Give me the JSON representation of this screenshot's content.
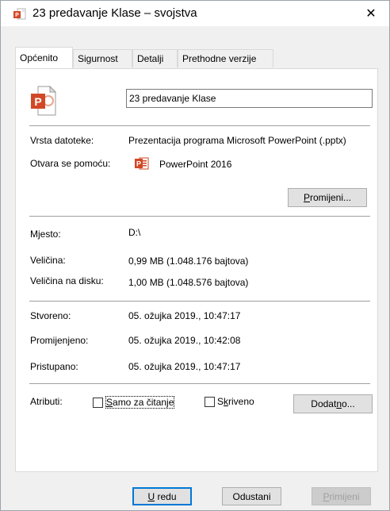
{
  "window": {
    "title": "23 predavanje Klase – svojstva",
    "close_glyph": "✕"
  },
  "tabs": [
    {
      "label": "Općenito",
      "active": true
    },
    {
      "label": "Sigurnost",
      "active": false
    },
    {
      "label": "Detalji",
      "active": false
    },
    {
      "label": "Prethodne verzije",
      "active": false
    }
  ],
  "general": {
    "file_name": "23 predavanje Klase",
    "file_type_label": "Vrsta datoteke:",
    "file_type_value": "Prezentacija programa Microsoft PowerPoint (.pptx)",
    "opens_with_label": "Otvara se pomoću:",
    "opens_with_value": "PowerPoint 2016",
    "change_button": {
      "pre": "P",
      "rest": "romijeni..."
    },
    "location_label": "Mjesto:",
    "location_value": "D:\\",
    "size_label": "Veličina:",
    "size_value": "0,99 MB (1.048.176 bajtova)",
    "size_on_disk_label": "Veličina na disku:",
    "size_on_disk_value": "1,00 MB (1.048.576 bajtova)",
    "created_label": "Stvoreno:",
    "created_value": "05. ožujka 2019., 10:47:17",
    "modified_label": "Promijenjeno:",
    "modified_value": "05. ožujka 2019., 10:42:08",
    "accessed_label": "Pristupano:",
    "accessed_value": "05. ožujka 2019., 10:47:17",
    "attributes_label": "Atributi:",
    "readonly": {
      "pre": "S",
      "rest": "amo za čitanje",
      "checked": false
    },
    "hidden": {
      "pre": "S",
      "mid": "k",
      "rest": "riveno",
      "checked": false
    },
    "advanced_button": {
      "pre": "Dodat",
      "u": "n",
      "rest": "o..."
    }
  },
  "footer": {
    "ok": {
      "u": "U",
      "rest": " redu"
    },
    "cancel": "Odustani",
    "apply": {
      "u": "P",
      "rest": "rimijeni"
    }
  },
  "colors": {
    "accent": "#0078d7",
    "ppt_red": "#d24726"
  },
  "icons": {
    "app": "powerpoint-file-icon",
    "close": "close-icon"
  }
}
